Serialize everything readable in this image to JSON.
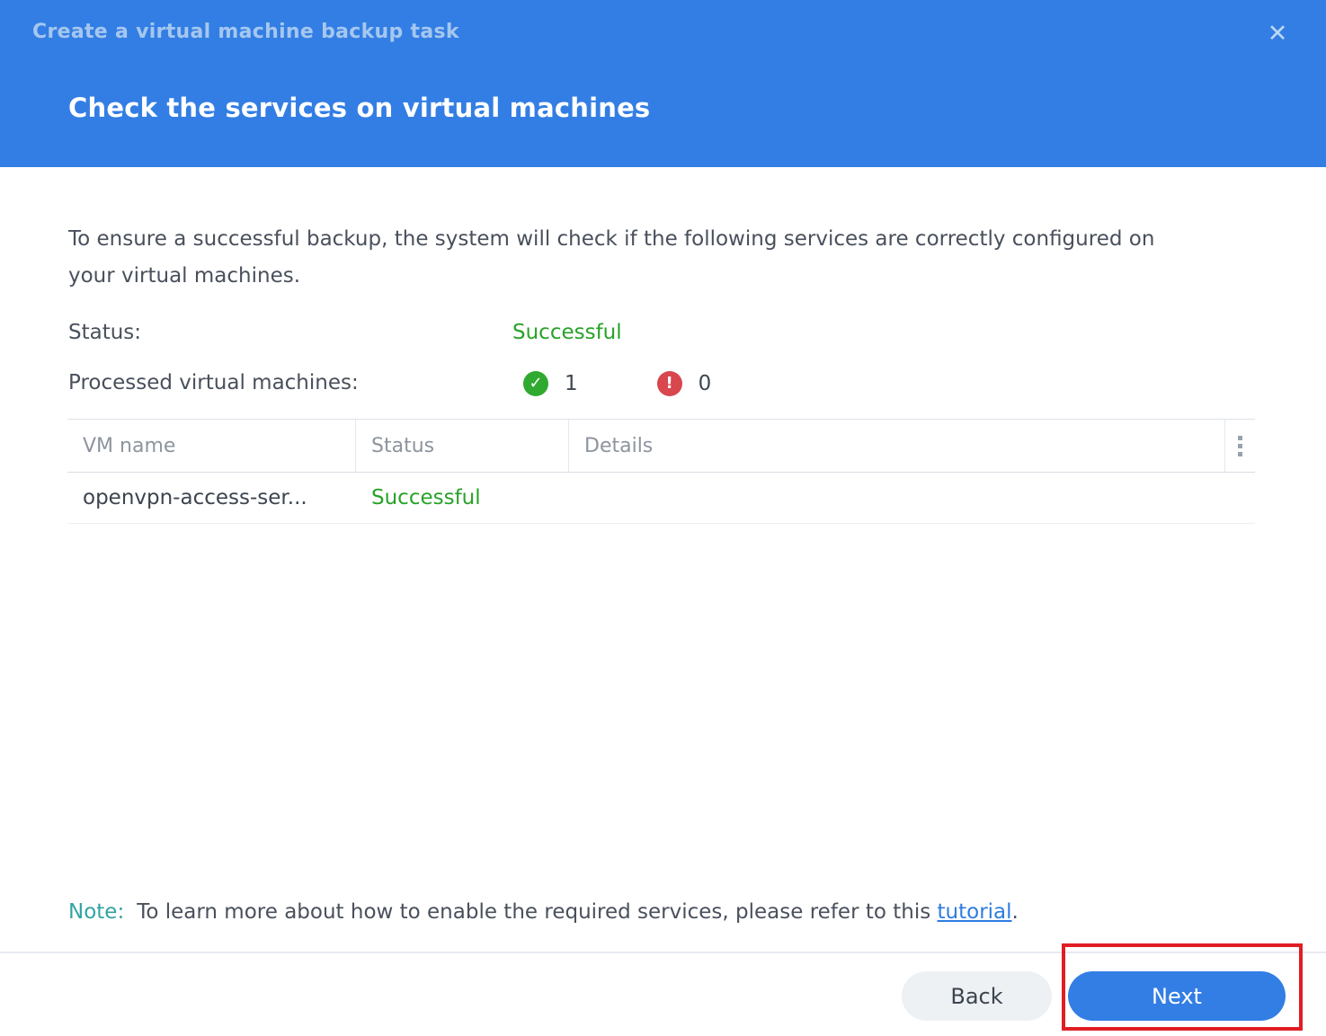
{
  "dialog": {
    "title": "Create a virtual machine backup task",
    "subtitle": "Check the services on virtual machines",
    "close_icon": "✕"
  },
  "body": {
    "description": "To ensure a successful backup, the system will check if the following services are correctly configured on your virtual machines.",
    "status_label": "Status:",
    "status_value": "Successful",
    "processed_label": "Processed virtual machines:",
    "success_icon": "✓",
    "success_count": "1",
    "error_icon": "!",
    "error_count": "0"
  },
  "table": {
    "columns": [
      "VM name",
      "Status",
      "Details"
    ],
    "rows": [
      {
        "vm_name": "openvpn-access-ser...",
        "status": "Successful",
        "details": ""
      }
    ]
  },
  "note": {
    "label": "Note:",
    "text_before_link": "To learn more about how to enable the required services, please refer to this ",
    "link_text": "tutorial",
    "text_after_link": "."
  },
  "footer": {
    "back_label": "Back",
    "next_label": "Next"
  },
  "colors": {
    "accent_blue": "#337ee4",
    "success_green": "#28a228",
    "success_icon_green": "#30a930",
    "error_red": "#d9464e",
    "note_teal": "#33a3a3",
    "link_blue": "#2e7ce0",
    "annotation_red": "#e11d24"
  }
}
